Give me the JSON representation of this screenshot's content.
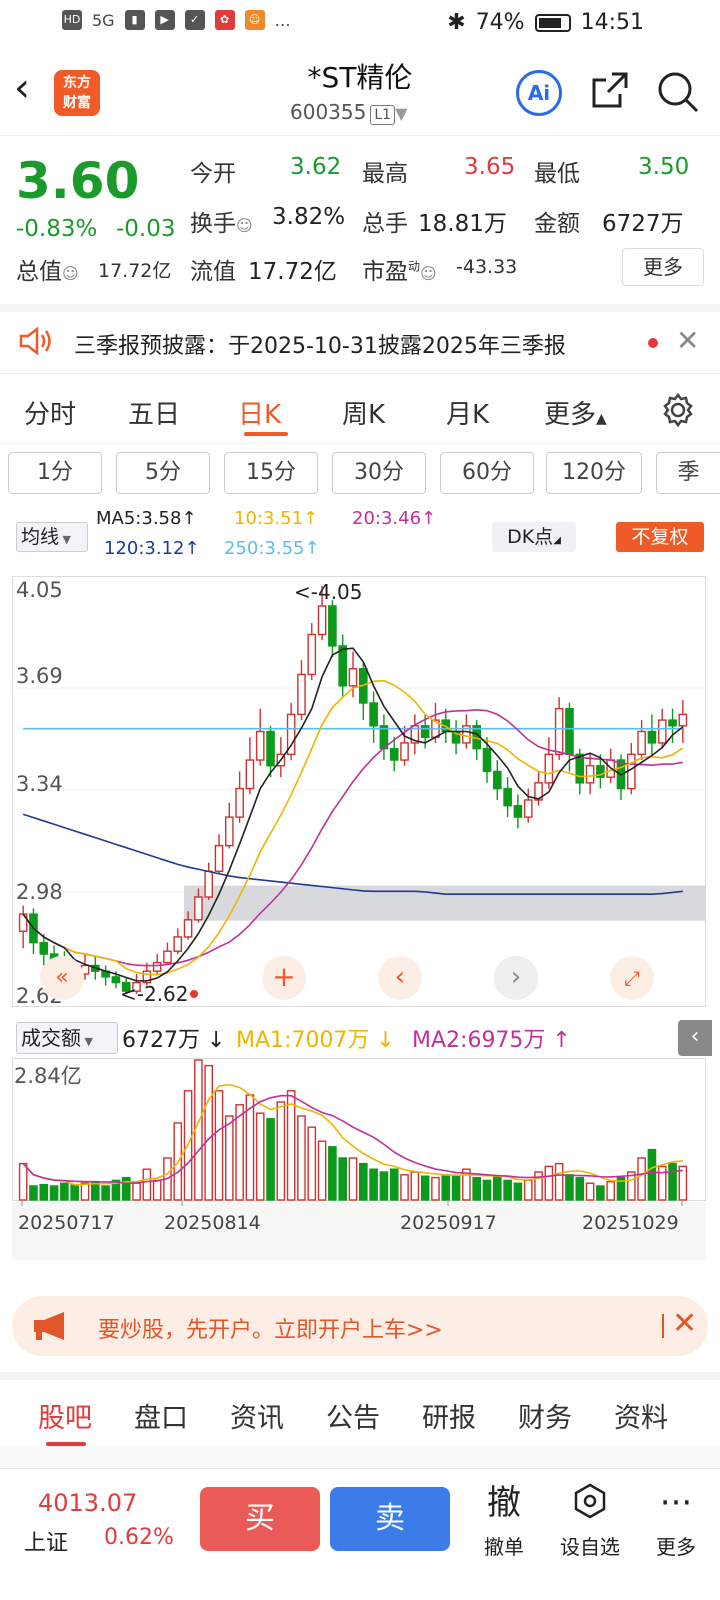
{
  "status_bar": {
    "battery": "74%",
    "time": "14:51",
    "net": "5G"
  },
  "header": {
    "stock_name": "*ST精伦",
    "stock_code": "600355",
    "level": "L1",
    "logo_line1": "东方",
    "logo_line2": "财富",
    "ai_label": "Ai"
  },
  "quote": {
    "price": "3.60",
    "change_pct": "-0.83%",
    "change": "-0.03",
    "open_label": "今开",
    "open": "3.62",
    "high_label": "最高",
    "high": "3.65",
    "low_label": "最低",
    "low": "3.50",
    "turnover_label": "换手",
    "turnover": "3.82%",
    "volume_label": "总手",
    "volume": "18.81万",
    "amount_label": "金额",
    "amount": "6727万",
    "mktcap_label": "总值",
    "mktcap": "17.72亿",
    "float_label": "流值",
    "float_cap": "17.72亿",
    "pe_label": "市盈",
    "pe_sup": "动",
    "pe": "-43.33",
    "more": "更多"
  },
  "notice": {
    "text": "三季报预披露：于2025-10-31披露2025年三季报"
  },
  "period_tabs": [
    "分时",
    "五日",
    "日K",
    "周K",
    "月K",
    "更多"
  ],
  "minute_tabs": [
    "1分",
    "5分",
    "15分",
    "30分",
    "60分",
    "120分",
    "季"
  ],
  "ma_bar": {
    "select": "均线",
    "ma5": "MA5:3.58↑",
    "ma10": "10:3.51↑",
    "ma20": "20:3.46↑",
    "ma120": "120:3.12↑",
    "ma250": "250:3.55↑",
    "dk": "DK点",
    "fq": "不复权",
    "colors": {
      "ma5": "#222222",
      "ma10": "#f0b400",
      "ma20": "#c0309c",
      "ma120": "#1f3a93",
      "ma250": "#5bbde8"
    }
  },
  "kline": {
    "y_ticks": [
      "4.05",
      "3.69",
      "3.34",
      "2.98",
      "2.62"
    ],
    "high_mark": "<-4.05",
    "low_mark": "<-2.62",
    "ymin": 2.62,
    "ymax": 4.05
  },
  "volume": {
    "select": "成交额",
    "value": "6727万 ↓",
    "ma1": "MA1:7007万 ↓",
    "ma2": "MA2:6975万 ↑",
    "y_top": "2.84亿",
    "dates": [
      "20250717",
      "20250814",
      "20250917",
      "20251029"
    ]
  },
  "chart_data": {
    "type": "candlestick",
    "ylim": [
      2.62,
      4.05
    ],
    "candles": [
      [
        2.84,
        2.9,
        2.93,
        2.78
      ],
      [
        2.9,
        2.8,
        2.92,
        2.76
      ],
      [
        2.8,
        2.76,
        2.83,
        2.72
      ],
      [
        2.76,
        2.74,
        2.79,
        2.7
      ],
      [
        2.74,
        2.71,
        2.77,
        2.68
      ],
      [
        2.71,
        2.69,
        2.74,
        2.66
      ],
      [
        2.69,
        2.72,
        2.76,
        2.67
      ],
      [
        2.72,
        2.7,
        2.75,
        2.67
      ],
      [
        2.7,
        2.68,
        2.72,
        2.65
      ],
      [
        2.68,
        2.66,
        2.7,
        2.64
      ],
      [
        2.66,
        2.63,
        2.68,
        2.62
      ],
      [
        2.63,
        2.66,
        2.69,
        2.62
      ],
      [
        2.66,
        2.7,
        2.73,
        2.65
      ],
      [
        2.7,
        2.73,
        2.76,
        2.69
      ],
      [
        2.73,
        2.77,
        2.8,
        2.72
      ],
      [
        2.77,
        2.82,
        2.85,
        2.76
      ],
      [
        2.82,
        2.88,
        2.91,
        2.81
      ],
      [
        2.88,
        2.96,
        2.99,
        2.87
      ],
      [
        2.96,
        3.05,
        3.08,
        2.95
      ],
      [
        3.05,
        3.14,
        3.18,
        3.04
      ],
      [
        3.14,
        3.24,
        3.29,
        3.13
      ],
      [
        3.24,
        3.34,
        3.4,
        3.22
      ],
      [
        3.34,
        3.44,
        3.52,
        3.32
      ],
      [
        3.44,
        3.54,
        3.62,
        3.42
      ],
      [
        3.54,
        3.42,
        3.56,
        3.38
      ],
      [
        3.42,
        3.46,
        3.52,
        3.38
      ],
      [
        3.46,
        3.6,
        3.64,
        3.44
      ],
      [
        3.6,
        3.74,
        3.79,
        3.58
      ],
      [
        3.74,
        3.88,
        3.92,
        3.72
      ],
      [
        3.88,
        3.98,
        4.05,
        3.86
      ],
      [
        3.98,
        3.84,
        4.0,
        3.8
      ],
      [
        3.84,
        3.7,
        3.88,
        3.66
      ],
      [
        3.7,
        3.76,
        3.82,
        3.66
      ],
      [
        3.76,
        3.64,
        3.78,
        3.58
      ],
      [
        3.64,
        3.56,
        3.68,
        3.5
      ],
      [
        3.56,
        3.48,
        3.6,
        3.44
      ],
      [
        3.48,
        3.44,
        3.52,
        3.4
      ],
      [
        3.44,
        3.5,
        3.56,
        3.42
      ],
      [
        3.5,
        3.56,
        3.6,
        3.46
      ],
      [
        3.56,
        3.52,
        3.6,
        3.48
      ],
      [
        3.52,
        3.58,
        3.64,
        3.5
      ],
      [
        3.58,
        3.54,
        3.62,
        3.5
      ],
      [
        3.54,
        3.5,
        3.58,
        3.46
      ],
      [
        3.5,
        3.56,
        3.6,
        3.48
      ],
      [
        3.56,
        3.48,
        3.58,
        3.44
      ],
      [
        3.48,
        3.4,
        3.52,
        3.36
      ],
      [
        3.4,
        3.34,
        3.44,
        3.3
      ],
      [
        3.34,
        3.28,
        3.38,
        3.24
      ],
      [
        3.28,
        3.24,
        3.32,
        3.2
      ],
      [
        3.24,
        3.3,
        3.34,
        3.22
      ],
      [
        3.3,
        3.36,
        3.4,
        3.28
      ],
      [
        3.36,
        3.46,
        3.52,
        3.34
      ],
      [
        3.46,
        3.62,
        3.66,
        3.44
      ],
      [
        3.62,
        3.46,
        3.64,
        3.4
      ],
      [
        3.46,
        3.36,
        3.48,
        3.32
      ],
      [
        3.36,
        3.42,
        3.46,
        3.32
      ],
      [
        3.42,
        3.38,
        3.46,
        3.34
      ],
      [
        3.38,
        3.44,
        3.48,
        3.36
      ],
      [
        3.44,
        3.34,
        3.46,
        3.3
      ],
      [
        3.34,
        3.46,
        3.5,
        3.32
      ],
      [
        3.46,
        3.54,
        3.58,
        3.44
      ],
      [
        3.54,
        3.5,
        3.6,
        3.46
      ],
      [
        3.5,
        3.58,
        3.62,
        3.48
      ],
      [
        3.58,
        3.56,
        3.62,
        3.5
      ],
      [
        3.56,
        3.6,
        3.65,
        3.5
      ]
    ],
    "volumes": [
      0.26,
      0.1,
      0.11,
      0.1,
      0.12,
      0.11,
      0.12,
      0.13,
      0.1,
      0.14,
      0.16,
      0.12,
      0.22,
      0.14,
      0.3,
      0.55,
      0.78,
      1.0,
      0.96,
      0.78,
      0.6,
      0.68,
      0.75,
      0.62,
      0.58,
      0.7,
      0.78,
      0.6,
      0.52,
      0.42,
      0.38,
      0.3,
      0.3,
      0.26,
      0.22,
      0.2,
      0.22,
      0.18,
      0.2,
      0.17,
      0.16,
      0.18,
      0.17,
      0.22,
      0.16,
      0.14,
      0.17,
      0.14,
      0.12,
      0.14,
      0.2,
      0.24,
      0.26,
      0.18,
      0.16,
      0.12,
      0.1,
      0.13,
      0.16,
      0.2,
      0.3,
      0.36,
      0.24,
      0.26,
      0.24
    ],
    "ma5": [],
    "ma10": [],
    "ma20": [],
    "ma120": [
      3.25,
      3.22,
      3.19,
      3.16,
      3.13,
      3.1,
      3.07,
      3.05,
      3.03,
      3.02,
      3.01,
      3.0,
      2.99,
      2.98,
      2.98,
      2.98,
      2.97,
      2.97,
      2.97,
      2.97,
      2.97,
      2.97,
      2.97,
      2.97,
      2.97,
      2.98
    ],
    "ma250": [
      3.55,
      3.55,
      3.55,
      3.55,
      3.55,
      3.55,
      3.55,
      3.55,
      3.55,
      3.55,
      3.55,
      3.55,
      3.55,
      3.55,
      3.55
    ]
  },
  "promo": {
    "text": "要炒股，先开户。立即开户上车>>"
  },
  "bottom_tabs": [
    "股吧",
    "盘口",
    "资讯",
    "公告",
    "研报",
    "财务",
    "资料"
  ],
  "bottom_bar": {
    "index_value": "4013.07",
    "index_name": "上证",
    "index_pct": "0.62%",
    "buy": "买",
    "sell": "卖",
    "cancel_icon": "撤",
    "cancel": "撤单",
    "watch": "设自选",
    "more": "更多"
  }
}
